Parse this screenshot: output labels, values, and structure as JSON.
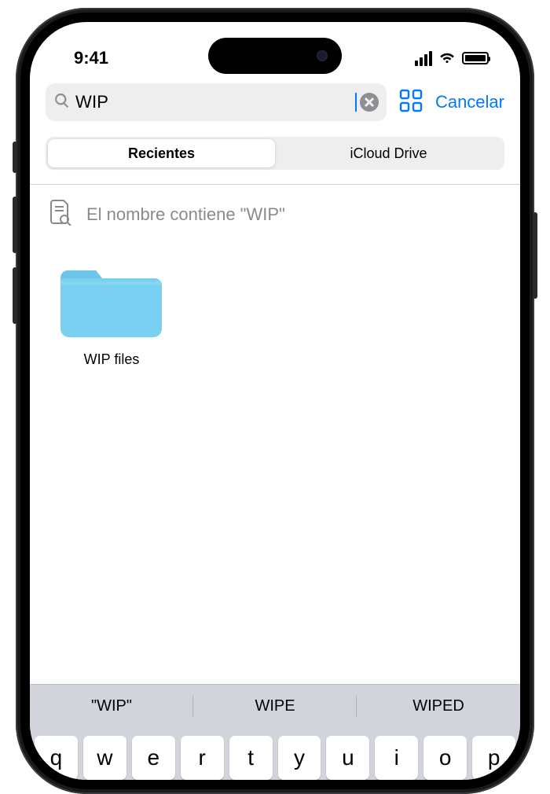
{
  "status_bar": {
    "time": "9:41"
  },
  "search": {
    "query": "WIP",
    "cancel_label": "Cancelar"
  },
  "tabs": {
    "recent": "Recientes",
    "icloud": "iCloud Drive"
  },
  "hint": {
    "text": "El nombre contiene \"WIP\""
  },
  "results": [
    {
      "name": "WIP files",
      "type": "folder"
    }
  ],
  "keyboard": {
    "suggestions": [
      "\"WIP\"",
      "WIPE",
      "WIPED"
    ],
    "row1": [
      "q",
      "w",
      "e",
      "r",
      "t",
      "y",
      "u",
      "i",
      "o",
      "p"
    ]
  },
  "colors": {
    "accent": "#007aff",
    "folder": "#79d0f1"
  }
}
